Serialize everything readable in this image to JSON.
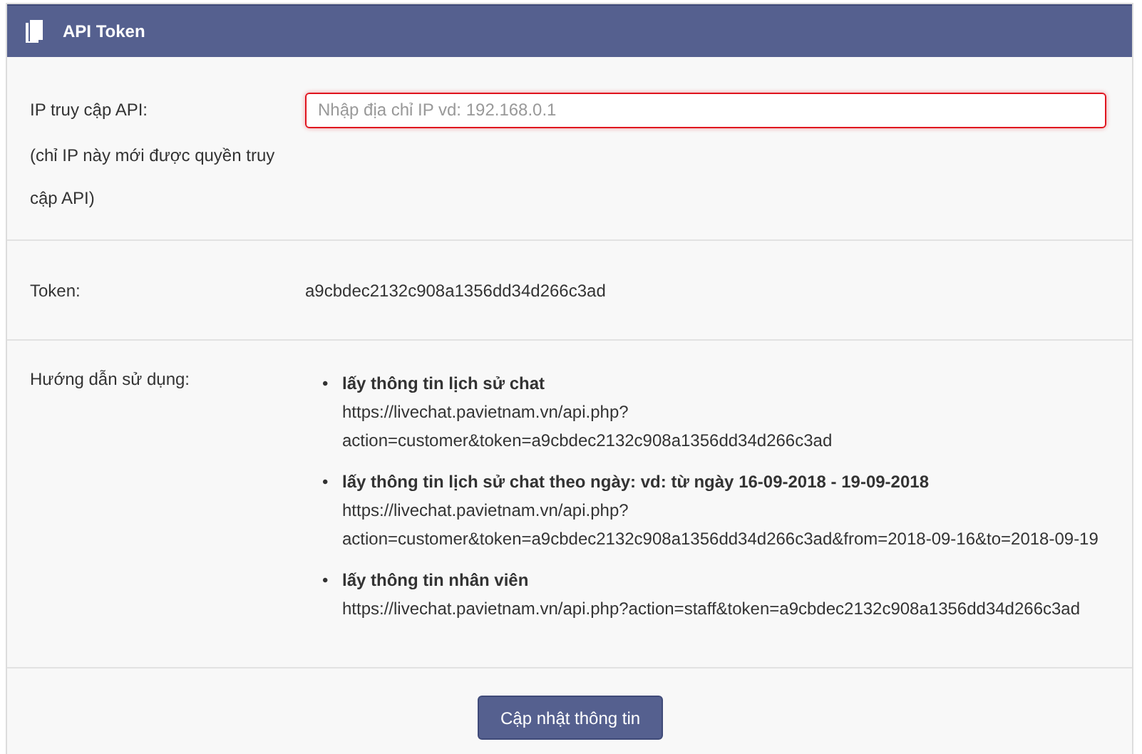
{
  "panel": {
    "title": "API Token"
  },
  "ip_row": {
    "label": "IP truy cập API:",
    "note": "(chỉ IP này mới được quyền truy cập API)",
    "placeholder": "Nhập địa chỉ IP vd: 192.168.0.1"
  },
  "token_row": {
    "label": "Token:",
    "value": "a9cbdec2132c908a1356dd34d266c3ad"
  },
  "guide_row": {
    "label": "Hướng dẫn sử dụng:",
    "items": [
      {
        "marker": "•",
        "title": "lấy thông tin lịch sử chat",
        "url": "https://livechat.pavietnam.vn/api.php?action=customer&token=a9cbdec2132c908a1356dd34d266c3ad"
      },
      {
        "marker": "•",
        "title": "lấy thông tin lịch sử chat theo ngày: vd: từ ngày 16-09-2018 - 19-09-2018",
        "url": "https://livechat.pavietnam.vn/api.php?action=customer&token=a9cbdec2132c908a1356dd34d266c3ad&from=2018-09-16&to=2018-09-19"
      },
      {
        "marker": "•",
        "title": "lấy thông tin nhân viên",
        "url": "https://livechat.pavietnam.vn/api.php?action=staff&token=a9cbdec2132c908a1356dd34d266c3ad"
      }
    ]
  },
  "submit_button": "Cập nhật thông tin"
}
